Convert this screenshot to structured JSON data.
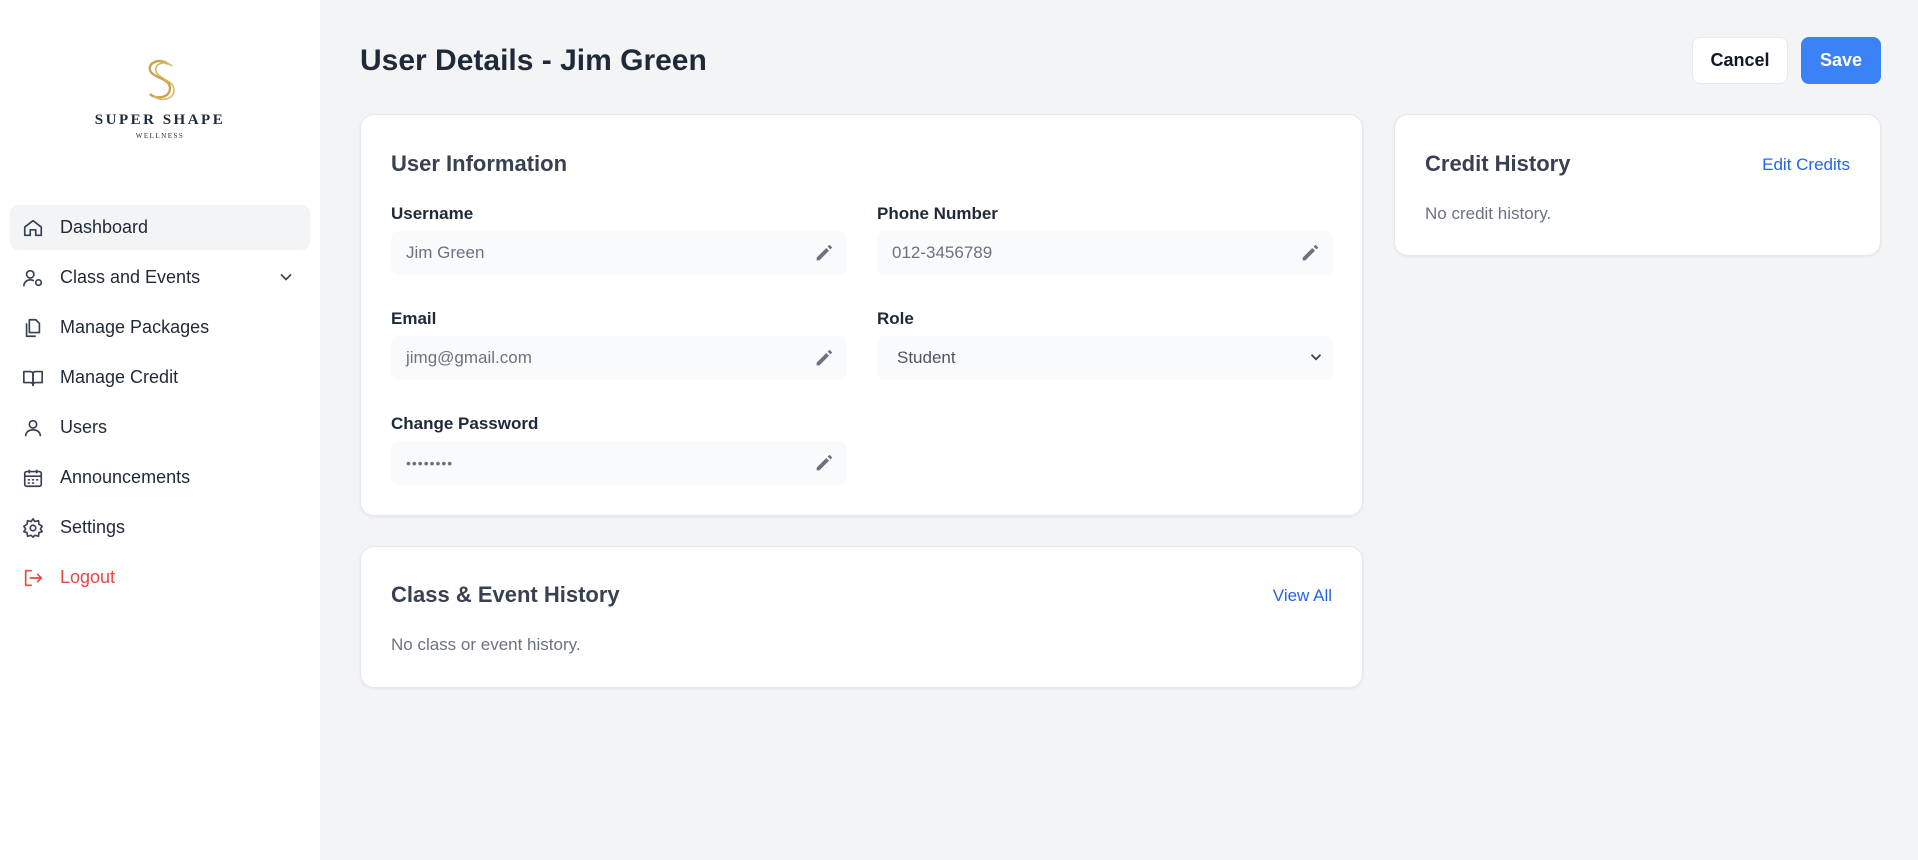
{
  "brand": {
    "name": "SUPER SHAPE",
    "tagline": "WELLNESS",
    "accent": "#c9a34e"
  },
  "sidebar": {
    "items": [
      {
        "label": "Dashboard",
        "icon": "home-icon"
      },
      {
        "label": "Class and Events",
        "icon": "user-cog-icon"
      },
      {
        "label": "Manage Packages",
        "icon": "copy-icon"
      },
      {
        "label": "Manage Credit",
        "icon": "book-open-icon"
      },
      {
        "label": "Users",
        "icon": "user-icon"
      },
      {
        "label": "Announcements",
        "icon": "calendar-icon"
      },
      {
        "label": "Settings",
        "icon": "gear-icon"
      },
      {
        "label": "Logout",
        "icon": "logout-icon"
      }
    ]
  },
  "header": {
    "title": "User Details - Jim Green",
    "cancel_label": "Cancel",
    "save_label": "Save"
  },
  "user_info": {
    "title": "User Information",
    "username": {
      "label": "Username",
      "value": "Jim Green"
    },
    "phone": {
      "label": "Phone Number",
      "value": "012-3456789"
    },
    "email": {
      "label": "Email",
      "value": "jimg@gmail.com"
    },
    "role": {
      "label": "Role",
      "value": "Student"
    },
    "password": {
      "label": "Change Password",
      "value": "••••••••"
    }
  },
  "class_history": {
    "title": "Class & Event History",
    "link": "View All",
    "empty": "No class or event history."
  },
  "credit_history": {
    "title": "Credit History",
    "link": "Edit Credits",
    "empty": "No credit history."
  },
  "colors": {
    "primary": "#3b82f6",
    "link": "#2563eb",
    "danger": "#ef4444",
    "background": "#f3f4f6"
  }
}
